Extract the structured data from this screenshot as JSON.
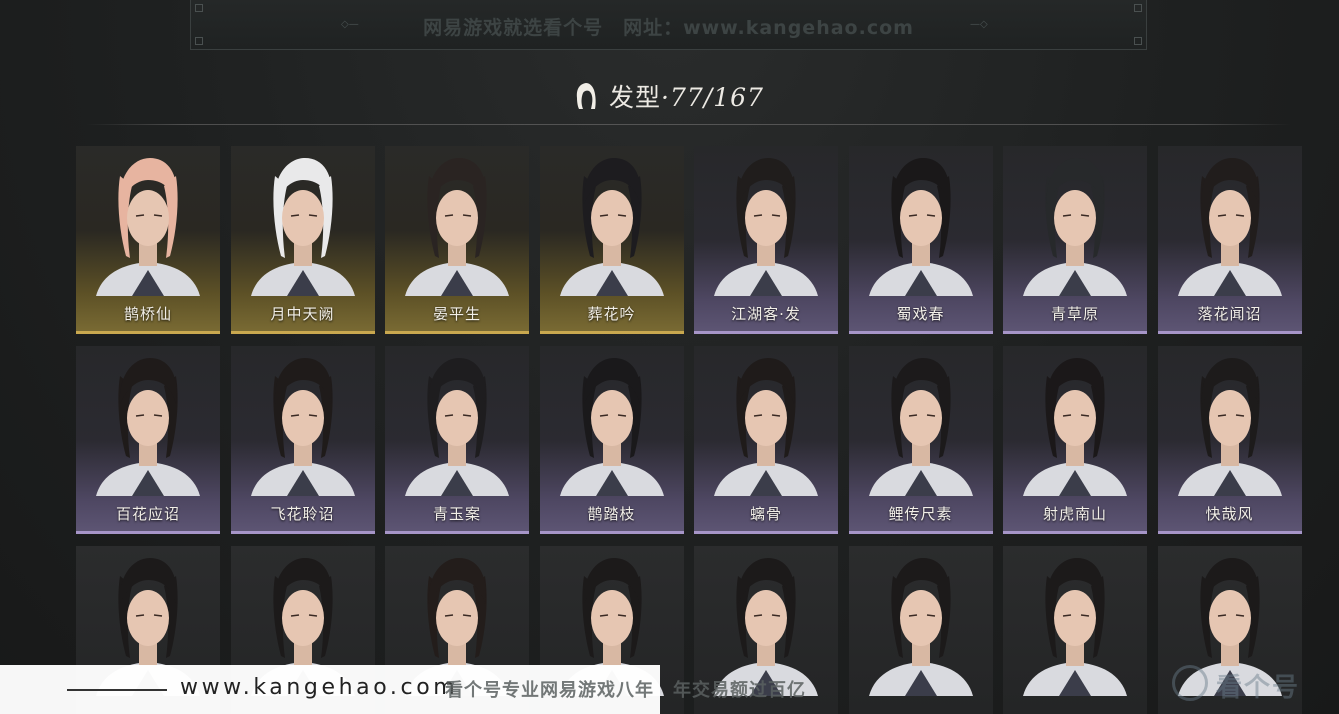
{
  "banner": {
    "text": "网易游戏就选看个号　网址：www.kangehao.com"
  },
  "header": {
    "title": "发型",
    "count": "·77/167",
    "icon": "hair-icon"
  },
  "grid": {
    "rows": [
      [
        {
          "name": "鹊桥仙",
          "tier": "gold",
          "hair": "#e7b4a0"
        },
        {
          "name": "月中天阙",
          "tier": "gold",
          "hair": "#e9e9ea"
        },
        {
          "name": "晏平生",
          "tier": "gold",
          "hair": "#2a2422"
        },
        {
          "name": "葬花吟",
          "tier": "gold",
          "hair": "#1d1c1f"
        },
        {
          "name": "江湖客·发",
          "tier": "purple",
          "hair": "#201d1c"
        },
        {
          "name": "蜀戏春",
          "tier": "purple",
          "hair": "#1a1819"
        },
        {
          "name": "青草原",
          "tier": "purple",
          "hair": "#27292b"
        },
        {
          "name": "落花闻诏",
          "tier": "purple",
          "hair": "#211d1c"
        }
      ],
      [
        {
          "name": "百花应诏",
          "tier": "purple",
          "hair": "#1f1b1a"
        },
        {
          "name": "飞花聆诏",
          "tier": "purple",
          "hair": "#1f1b1a"
        },
        {
          "name": "青玉案",
          "tier": "purple",
          "hair": "#1e1d1f"
        },
        {
          "name": "鹊踏枝",
          "tier": "purple",
          "hair": "#1a191b"
        },
        {
          "name": "螭骨",
          "tier": "purple",
          "hair": "#1f1b1a"
        },
        {
          "name": "鲤传尺素",
          "tier": "purple",
          "hair": "#1c1a1b"
        },
        {
          "name": "射虎南山",
          "tier": "purple",
          "hair": "#1b1819"
        },
        {
          "name": "快哉风",
          "tier": "purple",
          "hair": "#1d1b1b"
        }
      ],
      [
        {
          "name": "",
          "tier": "plain",
          "hair": "#1c1a1a"
        },
        {
          "name": "",
          "tier": "plain",
          "hair": "#1c1a1a"
        },
        {
          "name": "",
          "tier": "plain",
          "hair": "#231d1b"
        },
        {
          "name": "",
          "tier": "plain",
          "hair": "#1c1a1a"
        },
        {
          "name": "",
          "tier": "plain",
          "hair": "#1c1a1a"
        },
        {
          "name": "",
          "tier": "plain",
          "hair": "#1c1a1a"
        },
        {
          "name": "",
          "tier": "plain",
          "hair": "#1c1a1a"
        },
        {
          "name": "",
          "tier": "plain",
          "hair": "#1c1a1a"
        }
      ]
    ]
  },
  "watermark": {
    "url": "www.kangehao.com",
    "slogan": "看个号专业网易游戏八年　年交易额过百亿",
    "logo_text": "看个号"
  }
}
